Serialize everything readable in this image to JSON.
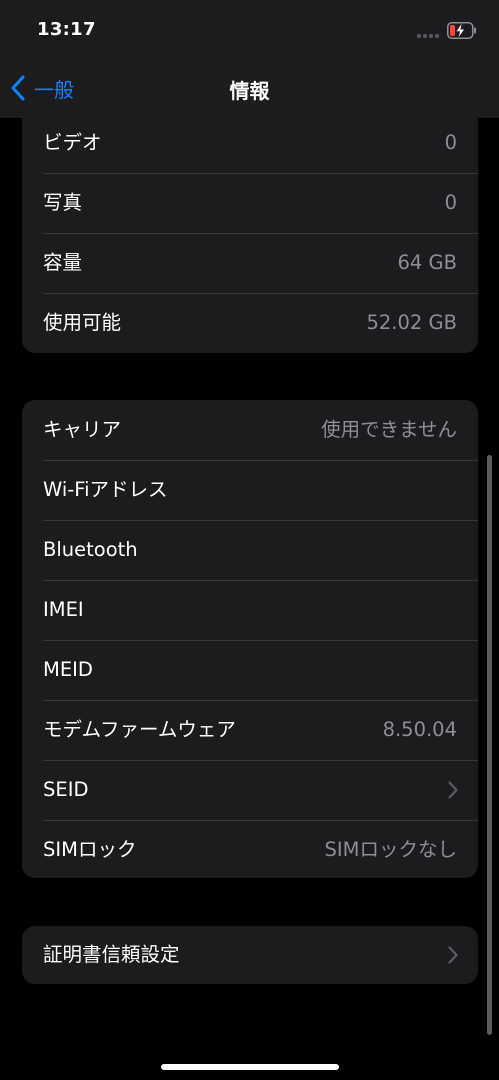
{
  "status_bar": {
    "time": "13:17",
    "battery_charging": true
  },
  "nav": {
    "back_label": "一般",
    "title": "情報"
  },
  "groups": [
    {
      "rows": [
        {
          "label": "ビデオ",
          "value": "0"
        },
        {
          "label": "写真",
          "value": "0"
        },
        {
          "label": "容量",
          "value": "64 GB"
        },
        {
          "label": "使用可能",
          "value": "52.02 GB"
        }
      ]
    },
    {
      "rows": [
        {
          "label": "キャリア",
          "value": "使用できません"
        },
        {
          "label": "Wi-Fiアドレス",
          "value": ""
        },
        {
          "label": "Bluetooth",
          "value": ""
        },
        {
          "label": "IMEI",
          "value": ""
        },
        {
          "label": "MEID",
          "value": ""
        },
        {
          "label": "モデムファームウェア",
          "value": "8.50.04"
        },
        {
          "label": "SEID",
          "value": "",
          "chevron": true
        },
        {
          "label": "SIMロック",
          "value": "SIMロックなし"
        }
      ]
    },
    {
      "rows": [
        {
          "label": "証明書信頼設定",
          "value": "",
          "chevron": true
        }
      ]
    }
  ],
  "colors": {
    "background": "#000000",
    "cell_background": "#1c1c1e",
    "separator": "#38383a",
    "accent": "#0a84ff",
    "secondary_text": "#8e8e93"
  },
  "icons": {
    "back": "chevron-left-icon",
    "row_disclosure": "chevron-right-icon",
    "battery": "battery-charging-icon",
    "signal": "signal-dots-icon"
  }
}
